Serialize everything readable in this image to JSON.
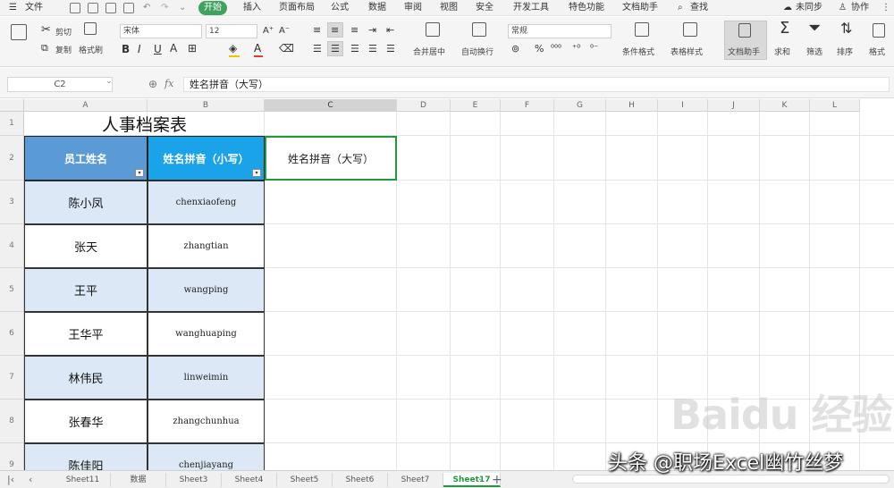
{
  "menubar": {
    "file_label": "文件",
    "items": [
      {
        "label": "开始",
        "active": true
      },
      {
        "label": "插入"
      },
      {
        "label": "页面布局"
      },
      {
        "label": "公式"
      },
      {
        "label": "数据"
      },
      {
        "label": "审阅"
      },
      {
        "label": "视图"
      },
      {
        "label": "安全"
      },
      {
        "label": "开发工具"
      },
      {
        "label": "特色功能"
      },
      {
        "label": "文档助手"
      }
    ],
    "search_label": "查找",
    "unsynced_label": "未同步",
    "collab_label": "协作"
  },
  "ribbon": {
    "cut_label": "剪切",
    "copy_label": "复制",
    "format_painter_label": "格式刷",
    "font_name": "宋体",
    "font_size": "12",
    "merge_center_label": "合并居中",
    "wrap_label": "自动换行",
    "number_format": "常规",
    "cond_format_label": "条件格式",
    "table_style_label": "表格样式",
    "doc_assistant_label": "文档助手",
    "sum_label": "求和",
    "filter_label": "筛选",
    "sort_label": "排序",
    "format_label": "格式"
  },
  "formula_bar": {
    "cell_ref": "C2",
    "fx_label": "fx",
    "content": "姓名拼音（大写）"
  },
  "grid": {
    "columns": [
      "A",
      "B",
      "C",
      "D",
      "E",
      "F",
      "G",
      "H",
      "I",
      "J",
      "K",
      "L"
    ],
    "row_numbers": [
      "1",
      "2",
      "3",
      "4",
      "5",
      "6",
      "7",
      "8",
      "9"
    ],
    "title": "人事档案表",
    "headers": {
      "a": "员工姓名",
      "b": "姓名拼音（小写）",
      "c": "姓名拼音（大写）"
    },
    "rows": [
      {
        "name": "陈小凤",
        "pinyin": "chenxiaofeng"
      },
      {
        "name": "张天",
        "pinyin": "zhangtian"
      },
      {
        "name": "王平",
        "pinyin": "wangping"
      },
      {
        "name": "王华平",
        "pinyin": "wanghuaping"
      },
      {
        "name": "林伟民",
        "pinyin": "linweimin"
      },
      {
        "name": "张春华",
        "pinyin": "zhangchunhua"
      },
      {
        "name": "陈佳阳",
        "pinyin": "chenjiayang"
      }
    ]
  },
  "sheet_tabs": {
    "tabs": [
      {
        "label": "Sheet11"
      },
      {
        "label": "数据"
      },
      {
        "label": "Sheet3"
      },
      {
        "label": "Sheet4"
      },
      {
        "label": "Sheet5"
      },
      {
        "label": "Sheet6"
      },
      {
        "label": "Sheet7"
      },
      {
        "label": "Sheet17",
        "active": true
      }
    ],
    "more_label": "···",
    "add_label": "+"
  },
  "watermarks": {
    "baidu": "Baidu 经验",
    "author": "头条 @职场Excel幽竹丝梦"
  },
  "colors": {
    "accent_green": "#3fa25e",
    "header_a_bg": "#5b9bd5",
    "header_b_bg": "#1aa3e8",
    "row_blue_bg": "#dce8f5",
    "selection_border": "#1e9a3a"
  }
}
